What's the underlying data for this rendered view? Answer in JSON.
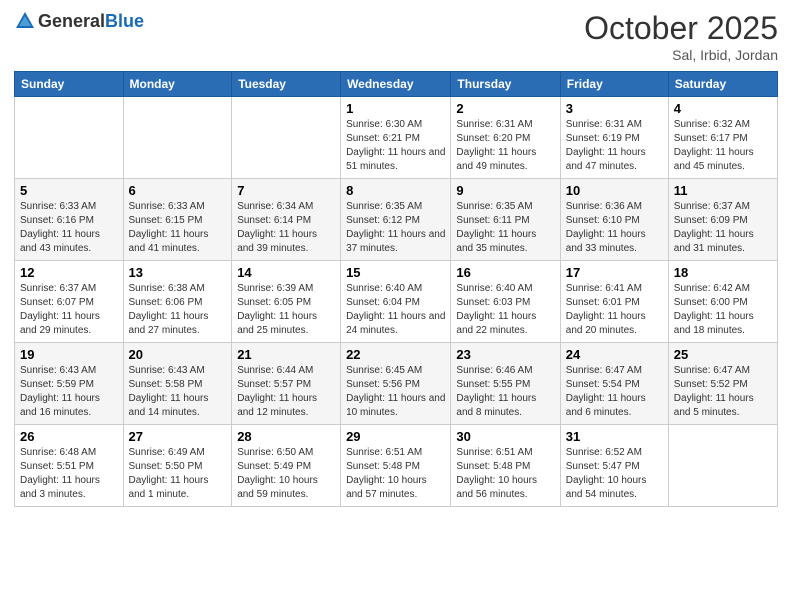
{
  "header": {
    "logo_general": "General",
    "logo_blue": "Blue",
    "month_title": "October 2025",
    "location": "Sal, Irbid, Jordan"
  },
  "calendar": {
    "days_of_week": [
      "Sunday",
      "Monday",
      "Tuesday",
      "Wednesday",
      "Thursday",
      "Friday",
      "Saturday"
    ],
    "weeks": [
      [
        {
          "day": "",
          "info": ""
        },
        {
          "day": "",
          "info": ""
        },
        {
          "day": "",
          "info": ""
        },
        {
          "day": "1",
          "info": "Sunrise: 6:30 AM\nSunset: 6:21 PM\nDaylight: 11 hours and 51 minutes."
        },
        {
          "day": "2",
          "info": "Sunrise: 6:31 AM\nSunset: 6:20 PM\nDaylight: 11 hours and 49 minutes."
        },
        {
          "day": "3",
          "info": "Sunrise: 6:31 AM\nSunset: 6:19 PM\nDaylight: 11 hours and 47 minutes."
        },
        {
          "day": "4",
          "info": "Sunrise: 6:32 AM\nSunset: 6:17 PM\nDaylight: 11 hours and 45 minutes."
        }
      ],
      [
        {
          "day": "5",
          "info": "Sunrise: 6:33 AM\nSunset: 6:16 PM\nDaylight: 11 hours and 43 minutes."
        },
        {
          "day": "6",
          "info": "Sunrise: 6:33 AM\nSunset: 6:15 PM\nDaylight: 11 hours and 41 minutes."
        },
        {
          "day": "7",
          "info": "Sunrise: 6:34 AM\nSunset: 6:14 PM\nDaylight: 11 hours and 39 minutes."
        },
        {
          "day": "8",
          "info": "Sunrise: 6:35 AM\nSunset: 6:12 PM\nDaylight: 11 hours and 37 minutes."
        },
        {
          "day": "9",
          "info": "Sunrise: 6:35 AM\nSunset: 6:11 PM\nDaylight: 11 hours and 35 minutes."
        },
        {
          "day": "10",
          "info": "Sunrise: 6:36 AM\nSunset: 6:10 PM\nDaylight: 11 hours and 33 minutes."
        },
        {
          "day": "11",
          "info": "Sunrise: 6:37 AM\nSunset: 6:09 PM\nDaylight: 11 hours and 31 minutes."
        }
      ],
      [
        {
          "day": "12",
          "info": "Sunrise: 6:37 AM\nSunset: 6:07 PM\nDaylight: 11 hours and 29 minutes."
        },
        {
          "day": "13",
          "info": "Sunrise: 6:38 AM\nSunset: 6:06 PM\nDaylight: 11 hours and 27 minutes."
        },
        {
          "day": "14",
          "info": "Sunrise: 6:39 AM\nSunset: 6:05 PM\nDaylight: 11 hours and 25 minutes."
        },
        {
          "day": "15",
          "info": "Sunrise: 6:40 AM\nSunset: 6:04 PM\nDaylight: 11 hours and 24 minutes."
        },
        {
          "day": "16",
          "info": "Sunrise: 6:40 AM\nSunset: 6:03 PM\nDaylight: 11 hours and 22 minutes."
        },
        {
          "day": "17",
          "info": "Sunrise: 6:41 AM\nSunset: 6:01 PM\nDaylight: 11 hours and 20 minutes."
        },
        {
          "day": "18",
          "info": "Sunrise: 6:42 AM\nSunset: 6:00 PM\nDaylight: 11 hours and 18 minutes."
        }
      ],
      [
        {
          "day": "19",
          "info": "Sunrise: 6:43 AM\nSunset: 5:59 PM\nDaylight: 11 hours and 16 minutes."
        },
        {
          "day": "20",
          "info": "Sunrise: 6:43 AM\nSunset: 5:58 PM\nDaylight: 11 hours and 14 minutes."
        },
        {
          "day": "21",
          "info": "Sunrise: 6:44 AM\nSunset: 5:57 PM\nDaylight: 11 hours and 12 minutes."
        },
        {
          "day": "22",
          "info": "Sunrise: 6:45 AM\nSunset: 5:56 PM\nDaylight: 11 hours and 10 minutes."
        },
        {
          "day": "23",
          "info": "Sunrise: 6:46 AM\nSunset: 5:55 PM\nDaylight: 11 hours and 8 minutes."
        },
        {
          "day": "24",
          "info": "Sunrise: 6:47 AM\nSunset: 5:54 PM\nDaylight: 11 hours and 6 minutes."
        },
        {
          "day": "25",
          "info": "Sunrise: 6:47 AM\nSunset: 5:52 PM\nDaylight: 11 hours and 5 minutes."
        }
      ],
      [
        {
          "day": "26",
          "info": "Sunrise: 6:48 AM\nSunset: 5:51 PM\nDaylight: 11 hours and 3 minutes."
        },
        {
          "day": "27",
          "info": "Sunrise: 6:49 AM\nSunset: 5:50 PM\nDaylight: 11 hours and 1 minute."
        },
        {
          "day": "28",
          "info": "Sunrise: 6:50 AM\nSunset: 5:49 PM\nDaylight: 10 hours and 59 minutes."
        },
        {
          "day": "29",
          "info": "Sunrise: 6:51 AM\nSunset: 5:48 PM\nDaylight: 10 hours and 57 minutes."
        },
        {
          "day": "30",
          "info": "Sunrise: 6:51 AM\nSunset: 5:48 PM\nDaylight: 10 hours and 56 minutes."
        },
        {
          "day": "31",
          "info": "Sunrise: 6:52 AM\nSunset: 5:47 PM\nDaylight: 10 hours and 54 minutes."
        },
        {
          "day": "",
          "info": ""
        }
      ]
    ]
  }
}
